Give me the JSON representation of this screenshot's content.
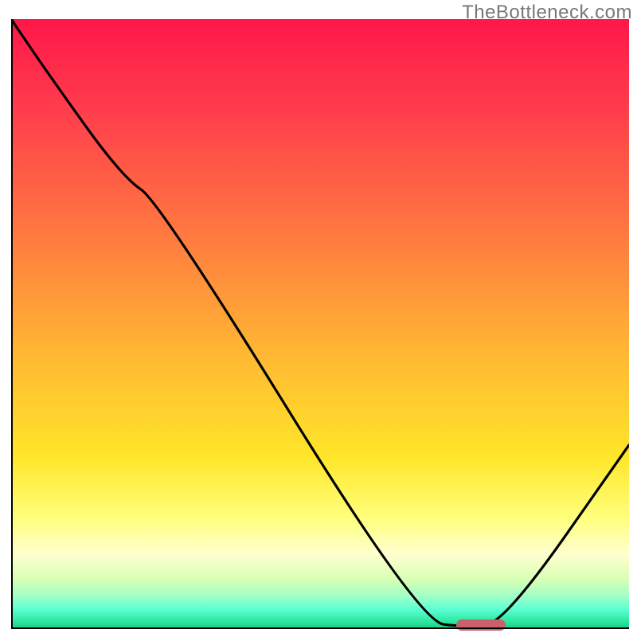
{
  "watermark": "TheBottleneck.com",
  "chart_data": {
    "type": "line",
    "x": [
      0,
      6,
      18,
      24,
      66,
      74,
      80,
      100
    ],
    "values": [
      100,
      91,
      74,
      70,
      1,
      0,
      1,
      30
    ],
    "title": "",
    "xlabel": "",
    "ylabel": "",
    "xlim": [
      0,
      100
    ],
    "ylim": [
      0,
      100
    ],
    "marker": {
      "x_start": 72,
      "x_end": 80,
      "y": 0
    }
  },
  "colors": {
    "marker": "#c9616a",
    "curve": "#000000"
  }
}
